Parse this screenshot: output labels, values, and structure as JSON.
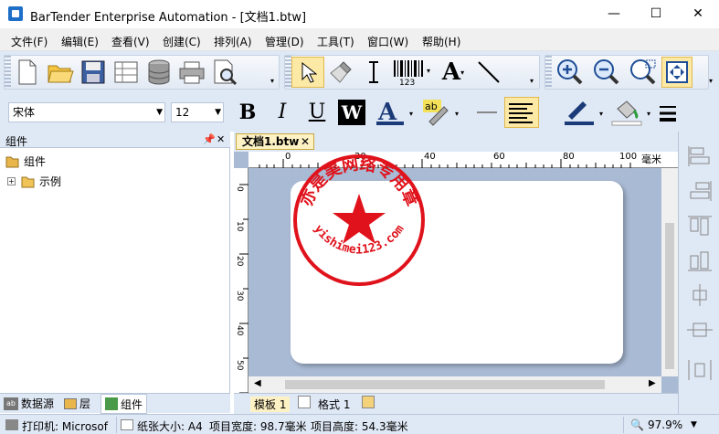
{
  "window": {
    "title": "BarTender Enterprise Automation - [文档1.btw]",
    "minimize": "—",
    "maximize": "☐",
    "close": "✕"
  },
  "menu": [
    "文件(F)",
    "编辑(E)",
    "查看(V)",
    "创建(C)",
    "排列(A)",
    "管理(D)",
    "工具(T)",
    "窗口(W)",
    "帮助(H)"
  ],
  "toolbar": {
    "font": "宋体",
    "size": "12",
    "bold": "B",
    "italic": "I",
    "underline": "U",
    "reverse": "W",
    "text_tool": "A"
  },
  "left_panel": {
    "title": "组件",
    "pin": "⊞",
    "close": "✕",
    "tree": [
      {
        "label": "组件"
      },
      {
        "label": "示例"
      }
    ],
    "tabs": [
      "数据源",
      "层",
      "组件"
    ]
  },
  "document": {
    "tab": "文档1.btw",
    "tab_close": "✕",
    "ruler_unit": "毫米",
    "ruler_h": [
      "0",
      "20",
      "40",
      "60",
      "80",
      "100"
    ],
    "ruler_v": [
      "0",
      "10",
      "20",
      "30",
      "40",
      "50"
    ],
    "sheet_tabs": [
      "模板 1",
      "格式 1"
    ]
  },
  "stamp": {
    "arc_text": "亦是美网络专用章",
    "bottom_text": "yishimei123.com",
    "color": "#e0121b"
  },
  "status": {
    "printer": "打印机: Microsof",
    "paper": "纸张大小: A4",
    "width": "项目宽度: 98.7毫米",
    "height": "项目高度: 54.3毫米",
    "zoom": "97.9%"
  }
}
